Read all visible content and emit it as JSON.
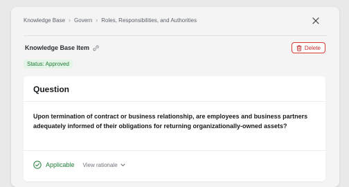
{
  "breadcrumb": {
    "items": [
      "Knowledge Base",
      "Govern",
      "Roles, Responsibilities, and Authorities"
    ]
  },
  "item": {
    "title": "Knowledge Base Item",
    "delete_label": "Delete",
    "status": "Status: Approved"
  },
  "card": {
    "title": "Question",
    "question": "Upon termination of contract or business relationship, are employees and business partners adequately informed of their obligations for returning organizationally-owned assets?",
    "answer_label": "Applicable",
    "rationale_label": "View rationale"
  },
  "colors": {
    "success": "#1e7b34",
    "danger": "#c62828",
    "badge_bg": "#e4f4e7"
  },
  "icons": {
    "close": "close-icon",
    "link": "link-icon",
    "delete": "trash-icon",
    "applicable": "check-circle-icon",
    "rationale": "chevron-down-icon"
  }
}
